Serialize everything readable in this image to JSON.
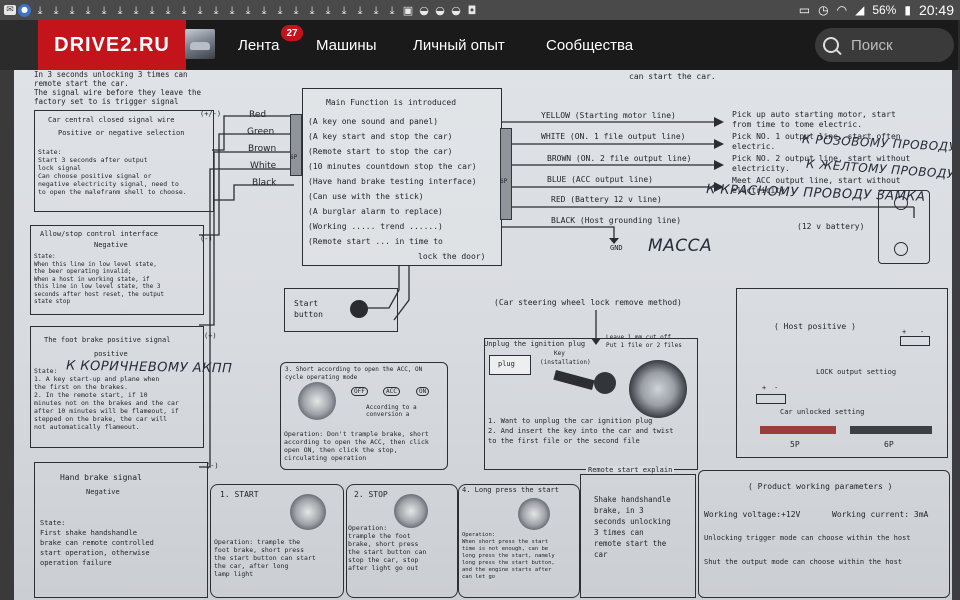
{
  "status_bar": {
    "battery": "56%",
    "time": "20:49"
  },
  "site": {
    "logo": "DRIVE2.RU",
    "nav": [
      {
        "label": "Лента",
        "badge": "27"
      },
      {
        "label": "Машины"
      },
      {
        "label": "Личный опыт"
      },
      {
        "label": "Сообщества"
      }
    ],
    "search_placeholder": "Поиск"
  },
  "document": {
    "top_left_notes": [
      "In 3 seconds unlocking 3 times can",
      "remote start the car.",
      "The signal wire before they leave the",
      "factory set to is trigger signal"
    ],
    "top_right_note": "can start the car.",
    "central_lock": {
      "title": "Car central closed signal wire",
      "sub": "Positive or negative selection",
      "state": "State:",
      "body": [
        "Start 3 seconds after output",
        "lock signal",
        "",
        "Can choose positive signal or",
        "negative electricity signal, need to",
        "to open the malefranm shell to choose."
      ]
    },
    "allow_stop": {
      "title": "Allow/stop control interface",
      "sub": "Negative",
      "state": "State:",
      "body": [
        "When this line in low level state,",
        "the beer operating invalid;",
        "When a host in working state, if",
        "this line in low level state, the 3",
        "seconds after host reset, the output",
        "state stop"
      ]
    },
    "foot_brake": {
      "title": "The foot brake positive signal",
      "sub": "positive",
      "state": "State:",
      "body": [
        "1. A key start-up and plane when",
        "the first on the brakes.",
        "2. In the remote start, if 10",
        "minutes not on the brakes and the car",
        "after 10 minutes will be flameout, if",
        "stepped on the brake, the car will",
        "not automatically flameout."
      ]
    },
    "hand_brake": {
      "title": "Hand brake signal",
      "sub": "Negative",
      "state": "State:",
      "body": [
        "First shake handshandle",
        "brake can remote controlled",
        "start operation, otherwise",
        "operation failure"
      ]
    },
    "polarity_marks": [
      "(+/-)",
      "(-)",
      "(+)",
      "(-)"
    ],
    "left_wires": [
      "Red",
      "Green",
      "Brown",
      "White",
      "Black"
    ],
    "left_connector": "6P",
    "right_connector": "6P",
    "main_box": {
      "title": "Main Function is introduced",
      "items": [
        "(A key one sound and panel)",
        "(A key start and stop the car)",
        "(Remote start to stop the car)",
        "(10 minutes countdown stop the car)",
        "(Have hand brake testing interface)",
        "(Can use with the stick)",
        "(A burglar alarm to replace)",
        "(Working ..... trend ......)",
        "(Remote start ... in time to",
        "lock the door)"
      ]
    },
    "start_button": "Start button",
    "right_wires": [
      {
        "label": "YELLOW (Starting motor line)",
        "desc": [
          "Pick up auto starting motor, start",
          "from time to tome electric."
        ]
      },
      {
        "label": "WHITE (ON. 1 file output line)",
        "desc": [
          "Pick NO. 1 output line, start often",
          "electric."
        ]
      },
      {
        "label": "BROWN (ON. 2 file output line)",
        "desc": [
          "Pick NO. 2 output line, start without",
          "electricity."
        ]
      },
      {
        "label": "BLUE (ACC output line)",
        "desc": [
          "Meet ACC output line, start without",
          "electricity"
        ]
      },
      {
        "label": "RED (Battery 12 v line)",
        "desc": []
      },
      {
        "label": "BLACK (Host grounding line)",
        "desc": []
      }
    ],
    "gnd": "GND",
    "battery": "(12 v battery)",
    "handwritten": [
      "К РОЗОВОМУ ПРОВОДУ",
      "К ЖЕЛТОМУ ПРОВОДУ",
      "К КРАСНОМУ ПРОВОДУ ЗАМКА",
      "МАССА",
      "К КОРИЧНЕВОМУ АКПП"
    ],
    "steering": {
      "title": "(Car steering wheel lock remove method)",
      "unplug": "Unplug the ignition plug",
      "plug": "plug",
      "key": "Key",
      "install": "(installation)",
      "leave": [
        "Leave 1 mm cut off",
        "Put 1 file or 2 files"
      ],
      "steps": [
        "1. Want to unplug the car ignition plug",
        "2. And insert the key into the car and twist",
        "to the first file or the second file"
      ]
    },
    "short_op": {
      "title": [
        "3. Short according to open the ACC, ON",
        "cycle operating mode"
      ],
      "states": [
        "OFF",
        "ACC",
        "ON"
      ],
      "conv": [
        "According to a",
        "conversion a"
      ],
      "op": [
        "Operation: Don't trample brake, short",
        "according to open the ACC, then click",
        "open ON, then click the stop,",
        "circulating operation"
      ]
    },
    "start_step": {
      "title": "1. START",
      "op": [
        "Operation: trample the",
        "foot brake, short press",
        "the start button can start",
        "the car, after long",
        "lamp light"
      ]
    },
    "stop_step": {
      "title": "2. STOP",
      "op": [
        "Operation:",
        "trample the foot",
        "brake, short press",
        "the start button can",
        "stop the car, stop",
        "after light go out"
      ]
    },
    "long_step": {
      "title": "4. Long press the start",
      "op": [
        "Operation:",
        "When short press the start",
        "time is not enough, can be",
        "long press the start, namely",
        "long press the start button,",
        "and the engine starts after",
        "can let go"
      ]
    },
    "remote_start": {
      "title": "Remote start explain",
      "body": [
        "Shake handshandle",
        "brake, in 3",
        "seconds unlocking",
        "3 times can",
        "remote start the",
        "car"
      ]
    },
    "host_positive": {
      "title": "( Host positive )",
      "lock_setting": "LOCK output settiog",
      "unlock_setting": "Car unlocked setting",
      "pins": [
        "+",
        "-",
        "+",
        "-"
      ],
      "conn_5p": "5P",
      "conn_6p": "6P"
    },
    "params": {
      "title": "( Product working parameters )",
      "voltage": "Working voltage:+12V",
      "current": "Working current: 3mA",
      "rows": [
        "Unlocking trigger mode can choose within the host",
        "Shut the output mode can choose within the host"
      ]
    }
  }
}
